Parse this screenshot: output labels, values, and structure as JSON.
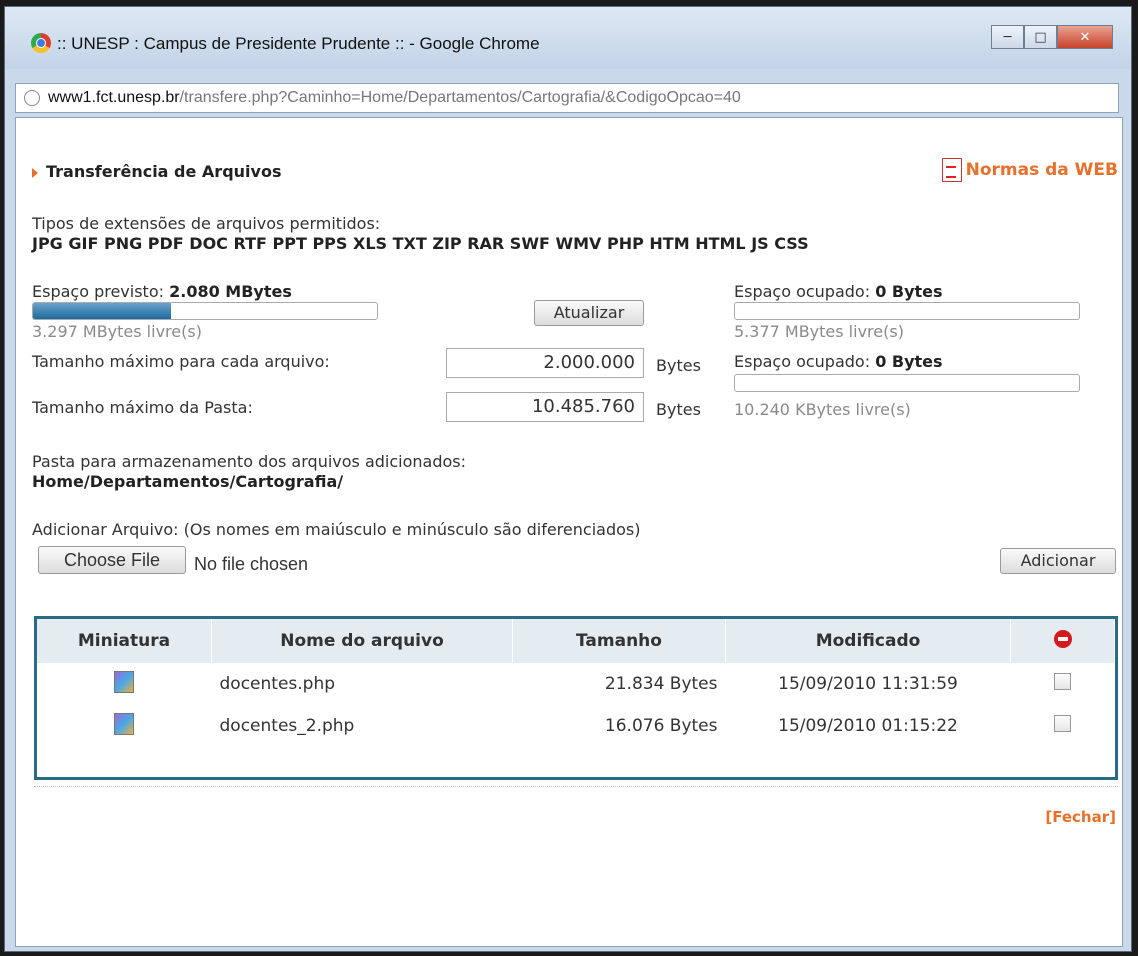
{
  "window": {
    "title": ":: UNESP : Campus de Presidente Prudente :: - Google Chrome",
    "url_host": "www1.fct.unesp.br",
    "url_path": "/transfere.php?Caminho=Home/Departamentos/Cartografia/&CodigoOpcao=40"
  },
  "header": {
    "title": "Transferência de Arquivos",
    "normas_link": "Normas da WEB"
  },
  "extensions": {
    "label": "Tipos de extensões de arquivos permitidos:",
    "list": "JPG GIF PNG PDF DOC RTF PPT PPS XLS TXT ZIP RAR SWF WMV PHP HTM HTML JS CSS"
  },
  "space": {
    "previsto_label": "Espaço previsto:",
    "previsto_value": "2.080 MBytes",
    "previsto_fill": 0.4,
    "previsto_free": "3.297 MBytes livre(s)",
    "atualizar": "Atualizar",
    "ocupado1_label": "Espaço ocupado:",
    "ocupado1_value": "0 Bytes",
    "ocupado1_free": "5.377 MBytes livre(s)",
    "ocupado2_label": "Espaço ocupado:",
    "ocupado2_value": "0 Bytes",
    "ocupado2_free": "10.240 KBytes livre(s)"
  },
  "limits": {
    "max_file_label": "Tamanho máximo para cada arquivo:",
    "max_file_value": "2.000.000",
    "max_folder_label": "Tamanho máximo da Pasta:",
    "max_folder_value": "10.485.760",
    "unit": "Bytes"
  },
  "folder": {
    "label": "Pasta para armazenamento dos arquivos adicionados:",
    "path": "Home/Departamentos/Cartografia/"
  },
  "upload": {
    "label": "Adicionar Arquivo: (Os nomes em maiúsculo e minúsculo são diferenciados)",
    "choose_file": "Choose File",
    "no_file": "No file chosen",
    "add_button": "Adicionar"
  },
  "table": {
    "headers": [
      "Miniatura",
      "Nome do arquivo",
      "Tamanho",
      "Modificado"
    ],
    "rows": [
      {
        "name": "docentes.php",
        "size": "21.834 Bytes",
        "modified": "15/09/2010 11:31:59"
      },
      {
        "name": "docentes_2.php",
        "size": "16.076 Bytes",
        "modified": "15/09/2010 01:15:22"
      }
    ]
  },
  "footer": {
    "fechar": "[Fechar]"
  },
  "colors": {
    "accent_orange": "#e8702a",
    "table_border": "#2a6a82",
    "progress_fill": "#1f6aa0"
  }
}
